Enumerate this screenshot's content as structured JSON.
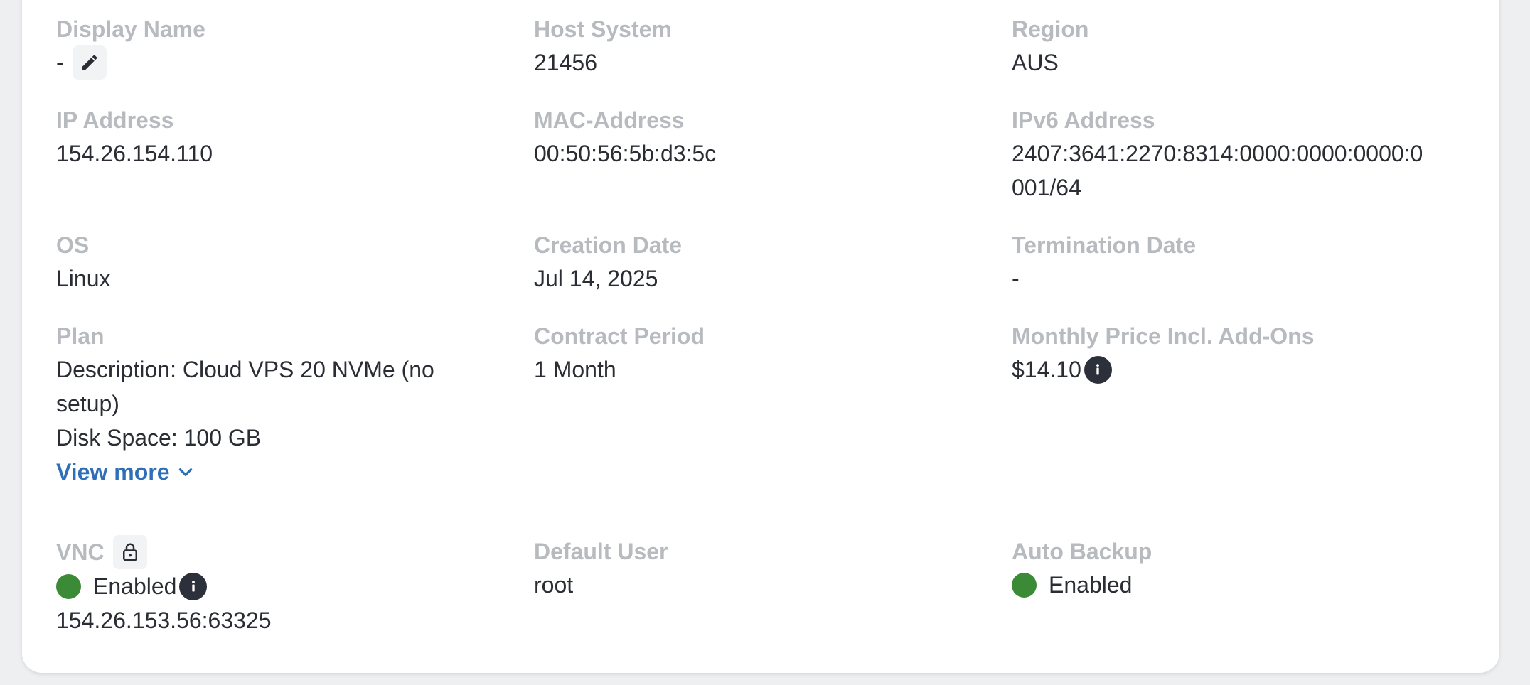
{
  "fields": {
    "display_name": {
      "label": "Display Name",
      "value": "-"
    },
    "host_system": {
      "label": "Host System",
      "value": "21456"
    },
    "region": {
      "label": "Region",
      "value": "AUS"
    },
    "ip_address": {
      "label": "IP Address",
      "value": "154.26.154.110"
    },
    "mac_address": {
      "label": "MAC-Address",
      "value": "00:50:56:5b:d3:5c"
    },
    "ipv6_address": {
      "label": "IPv6 Address",
      "value_line1": "2407:3641:2270:8314:0000:0000:0000:0",
      "value_line2": "001/64"
    },
    "os": {
      "label": "OS",
      "value": "Linux"
    },
    "creation_date": {
      "label": "Creation Date",
      "value": "Jul 14, 2025"
    },
    "termination_date": {
      "label": "Termination Date",
      "value": "-"
    },
    "plan": {
      "label": "Plan",
      "description_line1": "Description: Cloud VPS 20 NVMe (no",
      "description_line2": "setup)",
      "disk_space": "Disk Space: 100 GB",
      "view_more": "View more"
    },
    "contract_period": {
      "label": "Contract Period",
      "value": "1 Month"
    },
    "monthly_price": {
      "label": "Monthly Price Incl. Add-Ons",
      "value": "$14.10"
    },
    "vnc": {
      "label": "VNC",
      "status": "Enabled",
      "address": "154.26.153.56:63325"
    },
    "default_user": {
      "label": "Default User",
      "value": "root"
    },
    "auto_backup": {
      "label": "Auto Backup",
      "status": "Enabled"
    }
  },
  "icons": {
    "edit": "pencil-icon",
    "lock": "lock-icon",
    "info": "info-icon",
    "chevron": "chevron-down-icon"
  },
  "colors": {
    "label": "#b7babe",
    "value": "#2a2d33",
    "link": "#2f6fb8",
    "status_enabled": "#3a8a36",
    "info_bg": "#2b303a"
  }
}
